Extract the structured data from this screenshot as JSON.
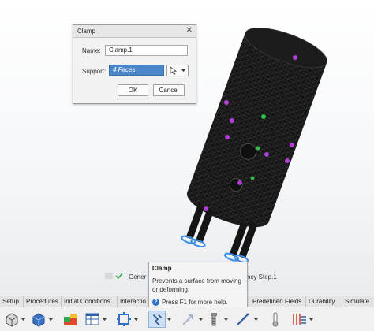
{
  "dialog": {
    "title": "Clamp",
    "name_label": "Name:",
    "name_value": "Clamp.1",
    "support_label": "Support:",
    "support_value": "4 Faces",
    "ok_label": "OK",
    "cancel_label": "Cancel"
  },
  "status": {
    "text_left": "Gener",
    "text_right": "ncy Step.1"
  },
  "tooltip": {
    "title": "Clamp",
    "description": "Prevents a surface from moving or deforming.",
    "help": "Press F1 for more help."
  },
  "tabs": [
    {
      "label": "Setup"
    },
    {
      "label": "Procedures"
    },
    {
      "label": "Initial Conditions"
    },
    {
      "label": "Interactio"
    },
    {
      "label": "Predefined Fields"
    },
    {
      "label": "Durability"
    },
    {
      "label": "Simulate"
    }
  ],
  "colors": {
    "selection": "#4a86c8",
    "mesh": "#141414",
    "highlight_blue": "#3a8ee6",
    "marker_purple": "#b03fd6",
    "marker_green": "#2fbf4a"
  },
  "toolbar_icons": [
    "part-icon",
    "mesh-icon",
    "material-icon",
    "table-icon",
    "interaction-icon",
    "clamp-icon",
    "load-icon",
    "bolt-icon",
    "displacement-icon",
    "temperature-icon",
    "field-icon"
  ]
}
